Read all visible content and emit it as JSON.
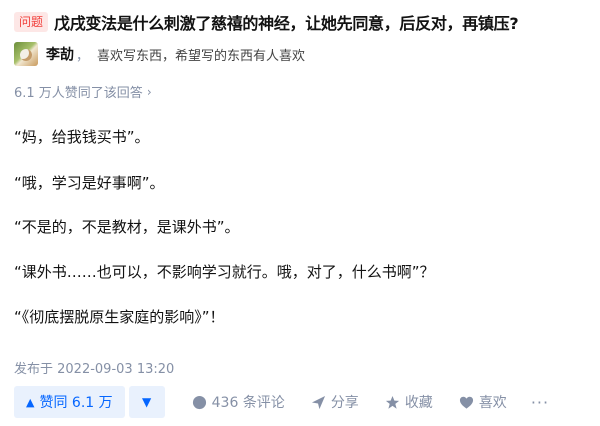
{
  "question": {
    "badge": "问题",
    "title": "戊戌变法是什么刺激了慈禧的神经，让她先同意，后反对，再镇压?"
  },
  "author": {
    "name": "李劼",
    "separator": "，",
    "bio": "喜欢写东西，希望写的东西有人喜欢"
  },
  "vote_summary": "6.1 万人赞同了该回答",
  "content": [
    "“妈，给我钱买书”。",
    "“哦，学习是好事啊”。",
    "“不是的，不是教材，是课外书”。",
    "“课外书……也可以，不影响学习就行。哦，对了，什么书啊”？",
    "“《彻底摆脱原生家庭的影响》”！"
  ],
  "published": "发布于 2022-09-03 13:20",
  "actions": {
    "upvote_label": "赞同 6.1 万",
    "comments_label": "436 条评论",
    "share_label": "分享",
    "collect_label": "收藏",
    "like_label": "喜欢",
    "more_label": "···"
  },
  "colors": {
    "accent": "#0566ff",
    "badge_bg": "#fde7e6",
    "badge_text": "#f1403c",
    "muted": "#8590a6"
  }
}
